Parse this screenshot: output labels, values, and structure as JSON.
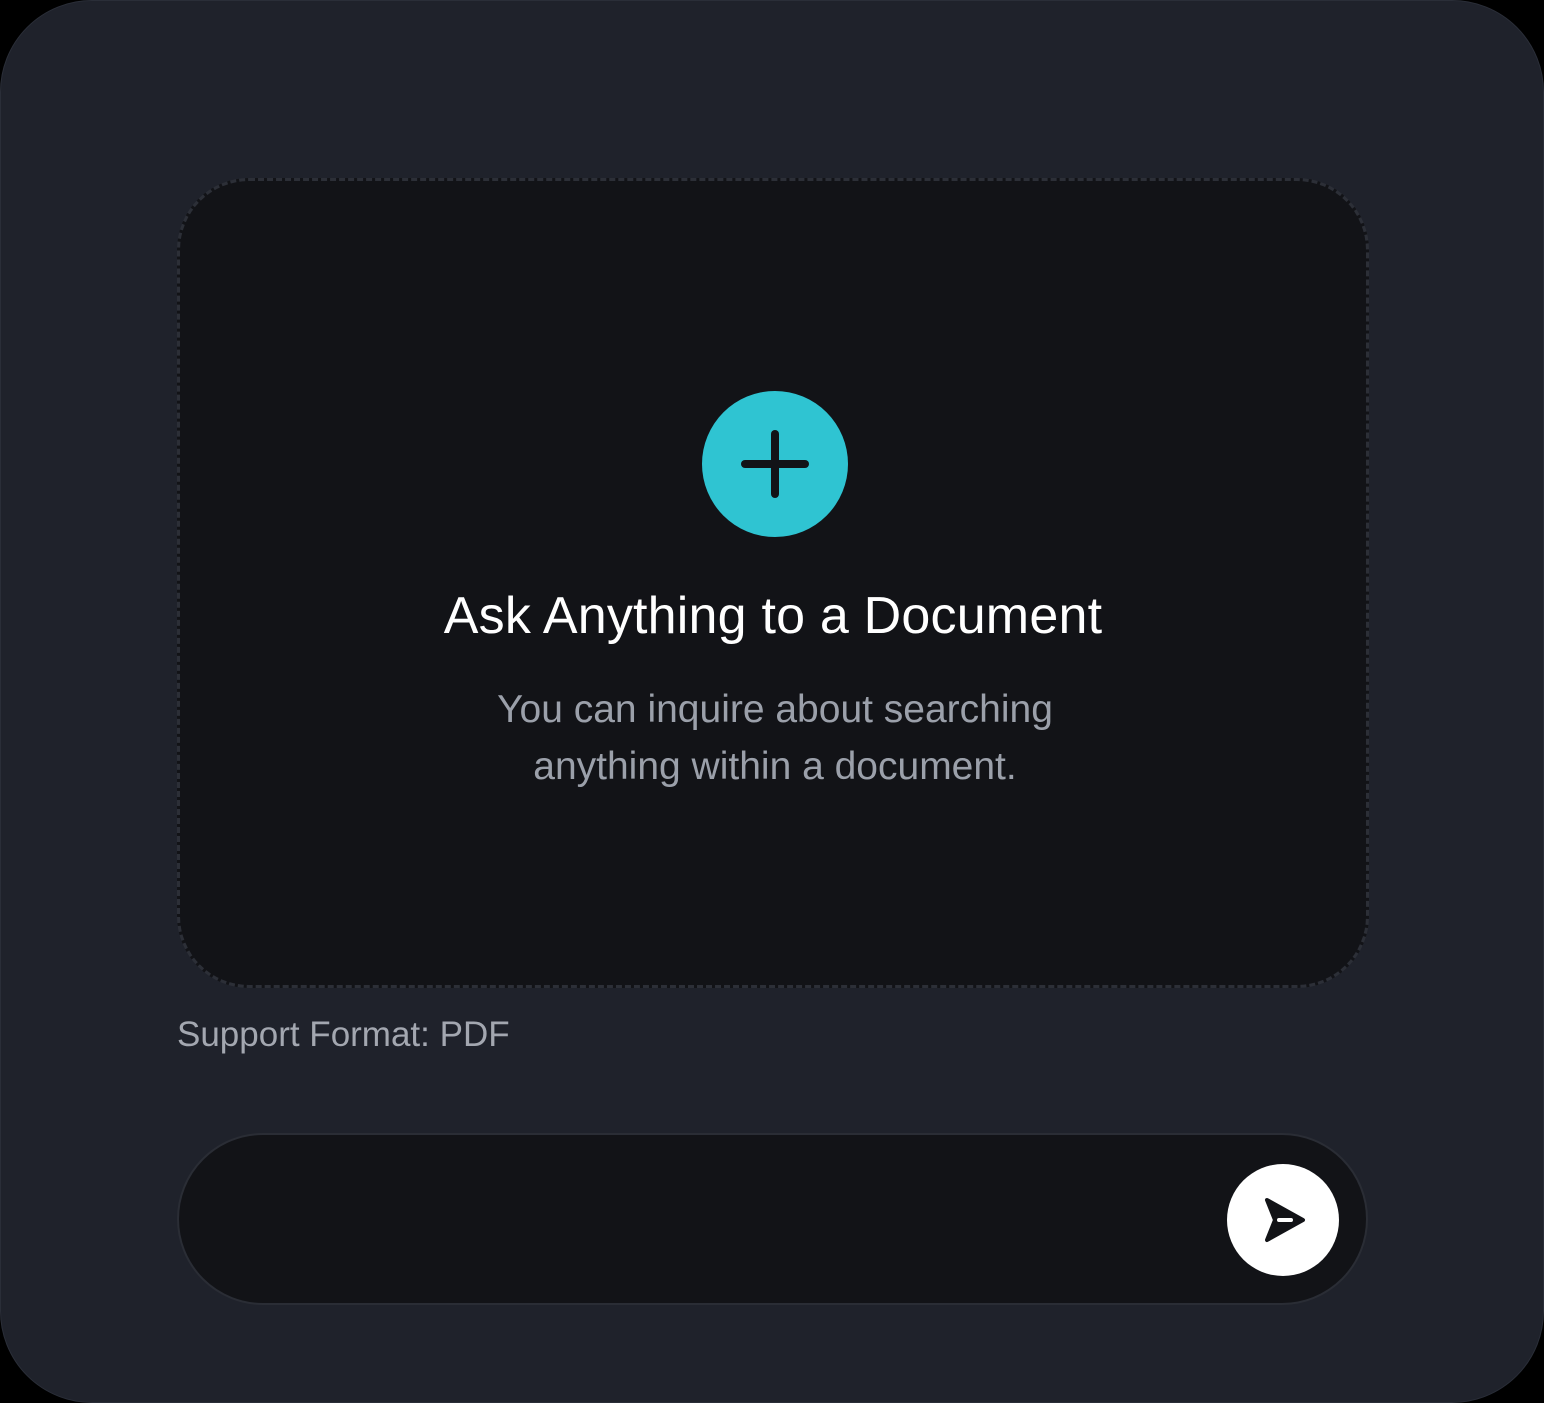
{
  "upload": {
    "title": "Ask Anything to a Document",
    "subtitle": "You can inquire about searching anything within a document.",
    "add_icon": "plus-icon"
  },
  "support_format": "Support Format: PDF",
  "chat": {
    "input_value": "",
    "input_placeholder": "",
    "send_icon": "send-arrow-icon"
  },
  "colors": {
    "background": "#1f222b",
    "panel": "#121317",
    "accent": "#2fc4d2",
    "text_primary": "#ffffff",
    "text_secondary": "#9ba0aa"
  }
}
